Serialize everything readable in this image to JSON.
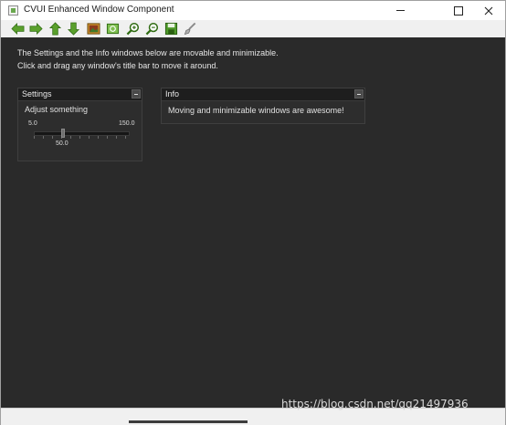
{
  "window": {
    "title": "CVUI Enhanced Window Component"
  },
  "toolbar": {
    "icons": [
      "arrow-left-icon",
      "arrow-right-icon",
      "arrow-up-icon",
      "arrow-down-icon",
      "image-icon",
      "zoom-fit-icon",
      "zoom-in-icon",
      "zoom-out-icon",
      "save-icon",
      "properties-icon"
    ]
  },
  "canvas": {
    "intro_line_1": "The Settings and the Info windows below are movable and minimizable.",
    "intro_line_2": "Click and drag any window's title bar to move it around."
  },
  "settings_window": {
    "title": "Settings",
    "label": "Adjust something",
    "trackbar": {
      "min_label": "5.0",
      "max_label": "150.0",
      "value_label": "50.0",
      "min": 5.0,
      "max": 150.0,
      "value": 50.0
    }
  },
  "info_window": {
    "title": "Info",
    "message": "Moving and minimizable windows are awesome!"
  },
  "watermark": "https://blog.csdn.net/qq21497936",
  "colors": {
    "canvas_bg": "#2a2a2a",
    "toolbar_green": "#5aa02c"
  }
}
